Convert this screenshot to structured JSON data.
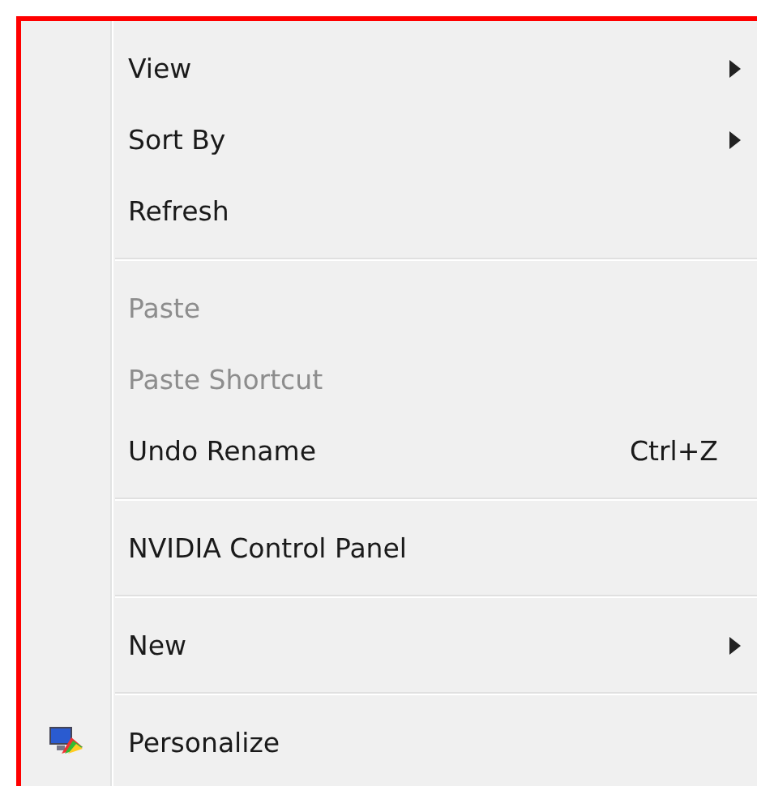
{
  "menu": {
    "sections": [
      {
        "items": [
          {
            "label": "View",
            "kind": "submenu",
            "disabled": false
          },
          {
            "label": "Sort By",
            "kind": "submenu",
            "disabled": false
          },
          {
            "label": "Refresh",
            "kind": "command",
            "disabled": false
          }
        ]
      },
      {
        "items": [
          {
            "label": "Paste",
            "kind": "command",
            "disabled": true
          },
          {
            "label": "Paste Shortcut",
            "kind": "command",
            "disabled": true
          },
          {
            "label": "Undo Rename",
            "kind": "command",
            "disabled": false,
            "shortcut": "Ctrl+Z"
          }
        ]
      },
      {
        "items": [
          {
            "label": "NVIDIA Control Panel",
            "kind": "command",
            "disabled": false
          }
        ]
      },
      {
        "items": [
          {
            "label": "New",
            "kind": "submenu",
            "disabled": false
          }
        ]
      },
      {
        "items": [
          {
            "label": "Personalize",
            "kind": "command",
            "disabled": false,
            "icon": true
          }
        ]
      }
    ]
  }
}
